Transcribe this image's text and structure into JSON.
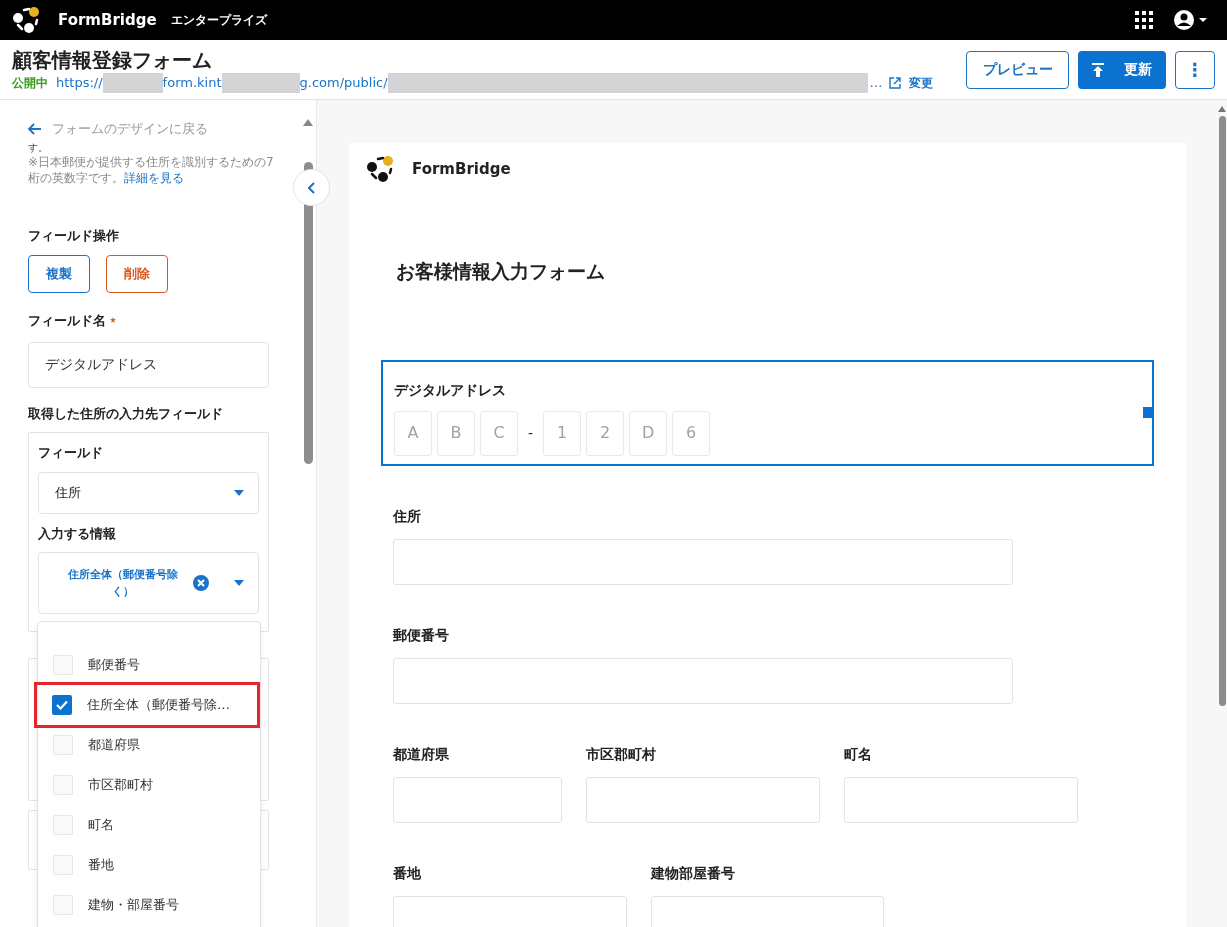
{
  "app_bar": {
    "brand": "FormBridge",
    "edition": "エンタープライズ"
  },
  "header": {
    "title": "顧客情報登録フォーム",
    "status": "公開中",
    "url_parts": [
      "https://",
      "form.kint",
      "g.com/public/"
    ],
    "url_more": "…",
    "change_link": "変更",
    "buttons": [
      {
        "kind": "outline",
        "label": "プレビュー"
      },
      {
        "kind": "primary",
        "label": "更新"
      },
      {
        "kind": "more",
        "label": "⋮"
      }
    ]
  },
  "side_panel": {
    "back_link": "フォームのデザインに戻る",
    "cut_line": "す。",
    "hint": "※日本郵便が提供する住所を識別するための7桁の英数字です。",
    "hint_link": "詳細を見る",
    "operations_label": "フィールド操作",
    "operations": [
      {
        "kind": "copy",
        "label": "複製"
      },
      {
        "kind": "delete",
        "label": "削除"
      }
    ],
    "name_label": "フィールド名",
    "name_required": true,
    "name_value": "デジタルアドレス",
    "target_label": "取得した住所の入力先フィールド",
    "field_label": "フィールド",
    "field_value": "住所",
    "info_label": "入力する情報",
    "info_chip": "住所全体（郵便番号除く）",
    "options": [
      {
        "label": "郵便番号",
        "checked": false,
        "highlighted": false
      },
      {
        "label": "住所全体（郵便番号除…",
        "checked": true,
        "highlighted": true
      },
      {
        "label": "都道府県",
        "checked": false,
        "highlighted": false
      },
      {
        "label": "市区郡町村",
        "checked": false,
        "highlighted": false
      },
      {
        "label": "町名",
        "checked": false,
        "highlighted": false
      },
      {
        "label": "番地",
        "checked": false,
        "highlighted": false
      },
      {
        "label": "建物・部屋番号",
        "checked": false,
        "highlighted": false
      }
    ]
  },
  "form_preview": {
    "brand": "FormBridge",
    "title": "お客様情報入力フォーム",
    "digital_address": {
      "label": "デジタルアドレス",
      "selected": true,
      "first": [
        "A",
        "B",
        "C"
      ],
      "separator": "-",
      "second": [
        "1",
        "2",
        "D",
        "6"
      ]
    },
    "rows": [
      [
        {
          "label": "住所"
        }
      ],
      [
        {
          "label": "郵便番号"
        }
      ],
      [
        {
          "label": "都道府県"
        },
        {
          "label": "市区郡町村"
        },
        {
          "label": "町名"
        }
      ],
      [
        {
          "label": "番地"
        },
        {
          "label": "建物部屋番号"
        }
      ]
    ]
  }
}
